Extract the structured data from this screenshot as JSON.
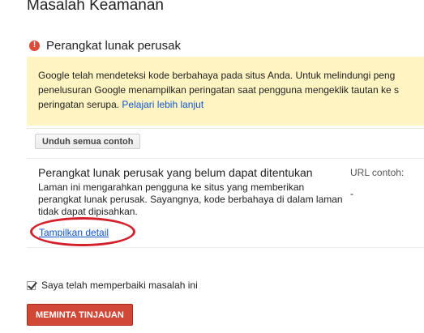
{
  "page": {
    "title": "Masalah Keamanan"
  },
  "section": {
    "title": "Perangkat lunak perusak",
    "icon": "error-exclamation-icon",
    "icon_glyph": "!"
  },
  "notice": {
    "line1": "Google telah mendeteksi kode berbahaya pada situs Anda. Untuk melindungi peng",
    "line2": "penelusuran Google menampilkan peringatan saat pengguna mengeklik tautan ke s",
    "line3": "peringatan serupa.",
    "link": "Pelajari lebih lanjut",
    "background": "#fff4c2"
  },
  "toolbar": {
    "download_label": "Unduh semua contoh"
  },
  "issue": {
    "title": "Perangkat lunak perusak yang belum dapat ditentukan",
    "description": "Laman ini mengarahkan pengguna ke situs yang memberikan perangkat lunak perusak. Sayangnya, kode berbahaya di dalam laman tidak dapat dipisahkan.",
    "show_detail": "Tampilkan detail"
  },
  "url_column": {
    "header": "URL contoh:",
    "value": "-"
  },
  "confirm": {
    "label": "Saya telah memperbaiki masalah ini",
    "checked": true
  },
  "review_button": {
    "label": "MEMINTA TINJAUAN",
    "color": "#d14836"
  },
  "colors": {
    "link": "#1155cc",
    "highlight": "#d4202a"
  }
}
